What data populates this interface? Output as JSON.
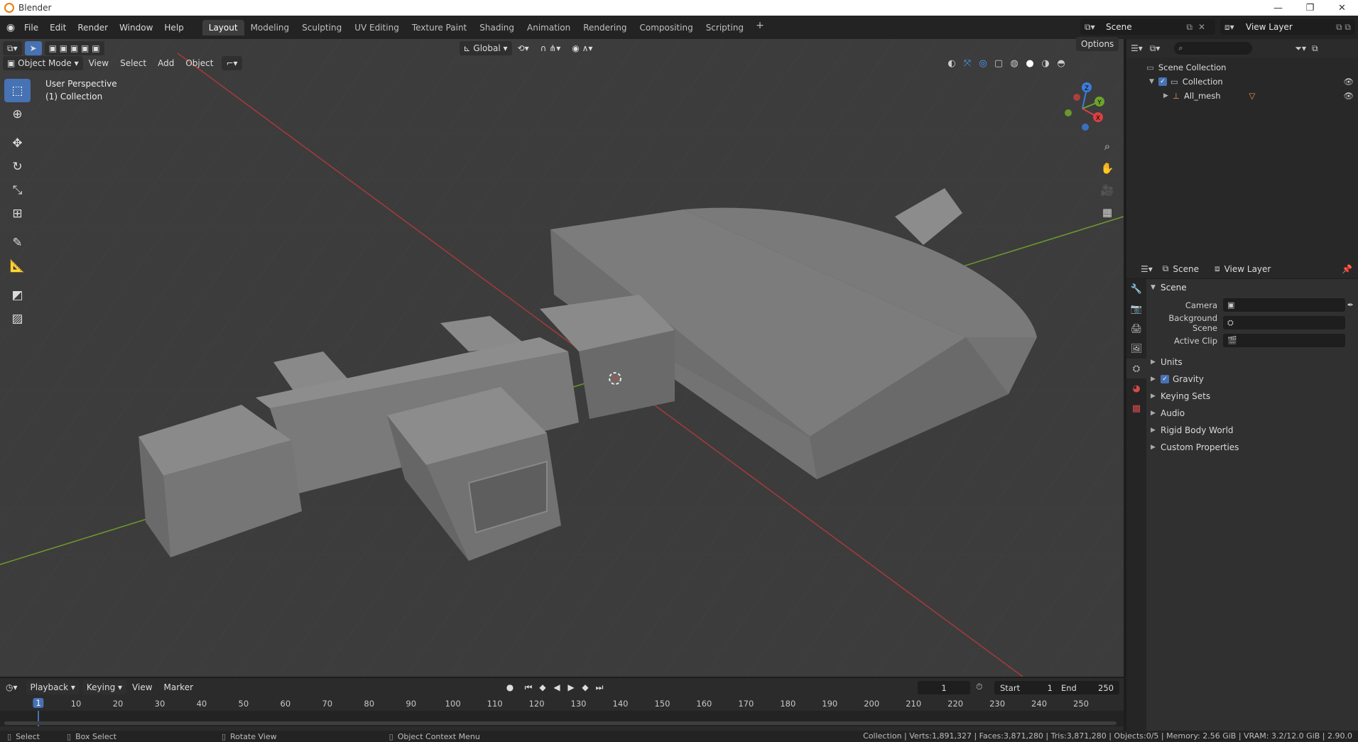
{
  "window": {
    "title": "Blender",
    "controls": [
      "—",
      "❐",
      "✕"
    ]
  },
  "menu": [
    "File",
    "Edit",
    "Render",
    "Window",
    "Help"
  ],
  "workspaces": [
    {
      "label": "Layout",
      "active": true
    },
    {
      "label": "Modeling"
    },
    {
      "label": "Sculpting"
    },
    {
      "label": "UV Editing"
    },
    {
      "label": "Texture Paint"
    },
    {
      "label": "Shading"
    },
    {
      "label": "Animation"
    },
    {
      "label": "Rendering"
    },
    {
      "label": "Compositing"
    },
    {
      "label": "Scripting"
    }
  ],
  "scene_selector": {
    "value": "Scene"
  },
  "view_layer_selector": {
    "value": "View Layer"
  },
  "tool_header": {
    "transform_orientation": "Global",
    "options_label": "Options"
  },
  "viewport_header": {
    "mode": "Object Mode",
    "menus": [
      "View",
      "Select",
      "Add",
      "Object"
    ]
  },
  "viewport_info": {
    "perspective": "User Perspective",
    "collection": "(1) Collection"
  },
  "gizmo": {
    "z": "Z",
    "y": "Y",
    "x": "X"
  },
  "outliner": {
    "search_placeholder": "⌕",
    "rows": [
      {
        "label": "Scene Collection"
      },
      {
        "label": "Collection"
      },
      {
        "label": "All_mesh"
      }
    ]
  },
  "properties": {
    "header_scene": "Scene",
    "header_view_layer": "View Layer",
    "panel_title": "Scene",
    "fields": [
      {
        "label": "Camera",
        "value": ""
      },
      {
        "label": "Background Scene",
        "value": ""
      },
      {
        "label": "Active Clip",
        "value": ""
      }
    ],
    "subpanels": [
      {
        "label": "Units",
        "checkbox": false
      },
      {
        "label": "Gravity",
        "checkbox": true
      },
      {
        "label": "Keying Sets",
        "checkbox": false
      },
      {
        "label": "Audio",
        "checkbox": false
      },
      {
        "label": "Rigid Body World",
        "checkbox": false
      },
      {
        "label": "Custom Properties",
        "checkbox": false
      }
    ]
  },
  "timeline": {
    "menus": [
      "Playback",
      "Keying",
      "View",
      "Marker"
    ],
    "current_frame": "1",
    "start_label": "Start",
    "start_value": "1",
    "end_label": "End",
    "end_value": "250",
    "ruler": [
      "1",
      "10",
      "20",
      "30",
      "40",
      "50",
      "60",
      "70",
      "80",
      "90",
      "100",
      "110",
      "120",
      "130",
      "140",
      "150",
      "160",
      "170",
      "180",
      "190",
      "200",
      "210",
      "220",
      "230",
      "240",
      "250"
    ]
  },
  "statusbar": {
    "select": "Select",
    "box_select": "Box Select",
    "rotate_view": "Rotate View",
    "context_menu": "Object Context Menu",
    "stats": "Collection | Verts:1,891,327 | Faces:3,871,280 | Tris:3,871,280 | Objects:0/5 | Memory: 2.56 GiB | VRAM: 3.2/12.0 GiB | 2.90.0"
  },
  "colors": {
    "accent": "#4772b3",
    "x_axis": "#c73b3b",
    "y_axis": "#6a9a2a"
  }
}
